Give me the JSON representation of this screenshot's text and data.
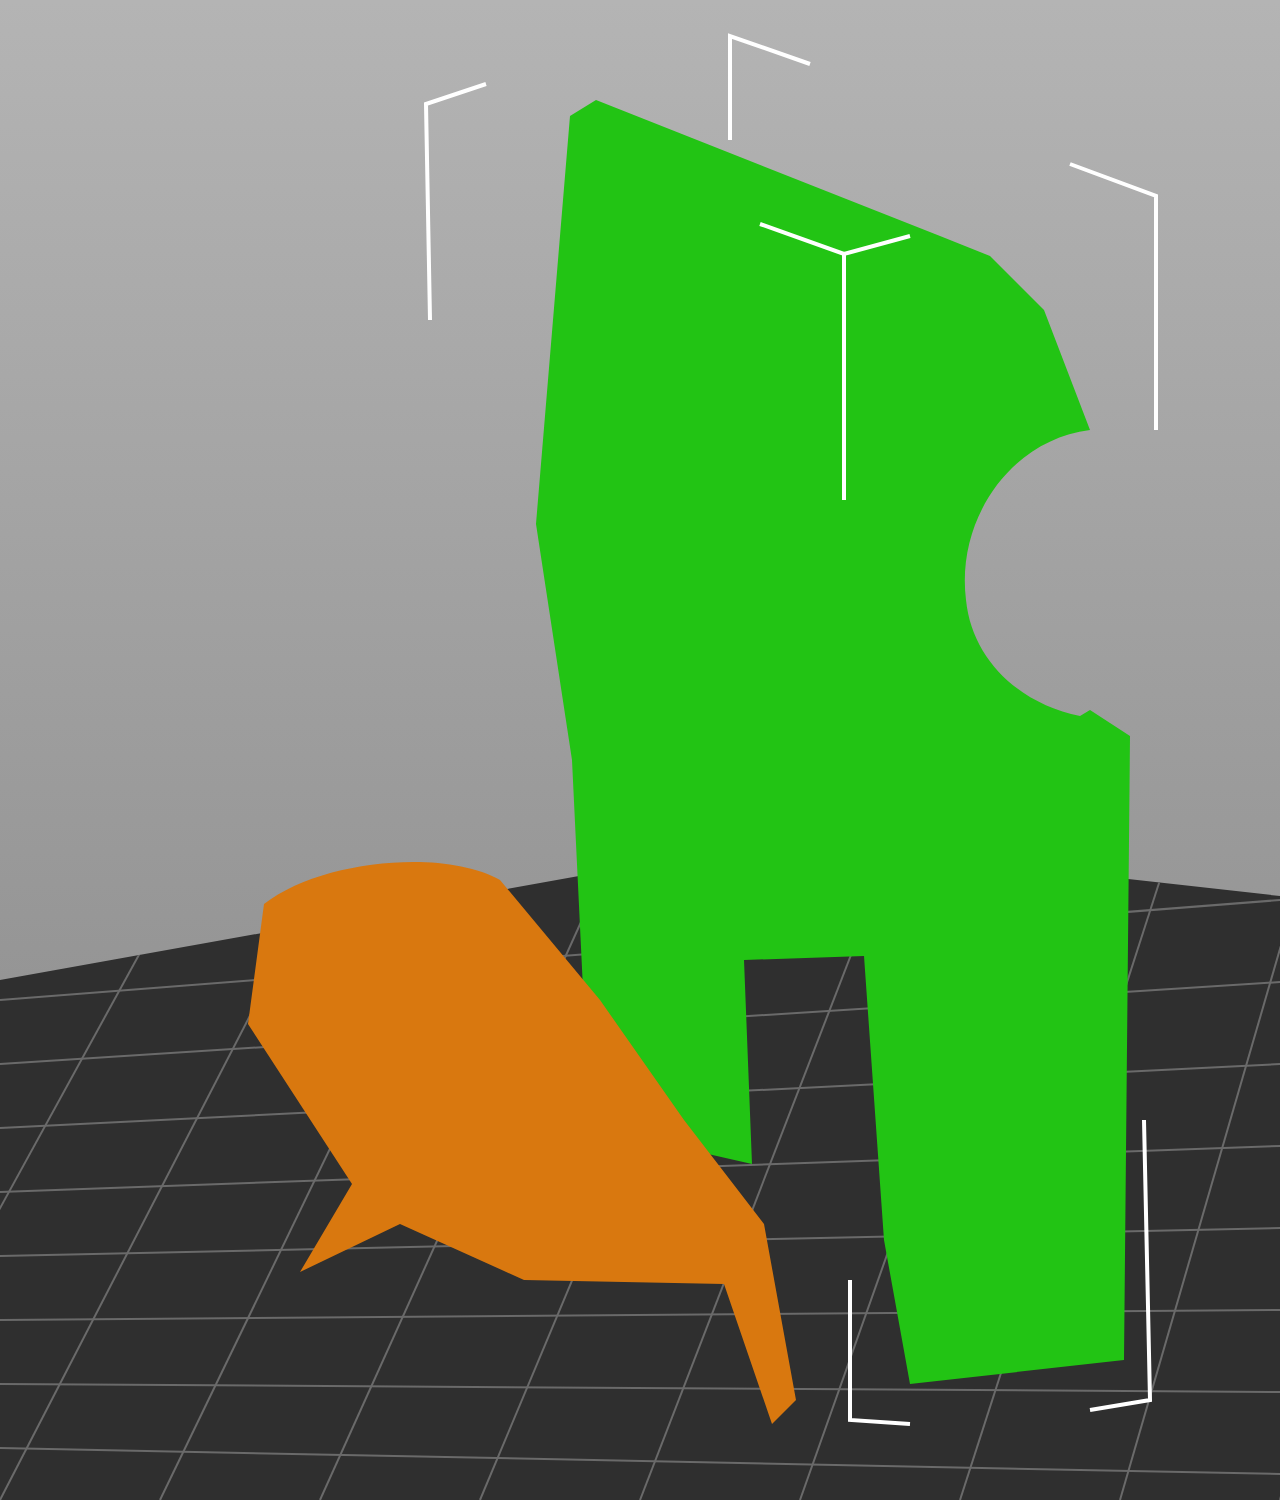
{
  "viewport": {
    "objects": [
      {
        "kind": "housing",
        "color": "#22c414"
      },
      {
        "kind": "cover",
        "color": "#d9780f"
      }
    ]
  }
}
